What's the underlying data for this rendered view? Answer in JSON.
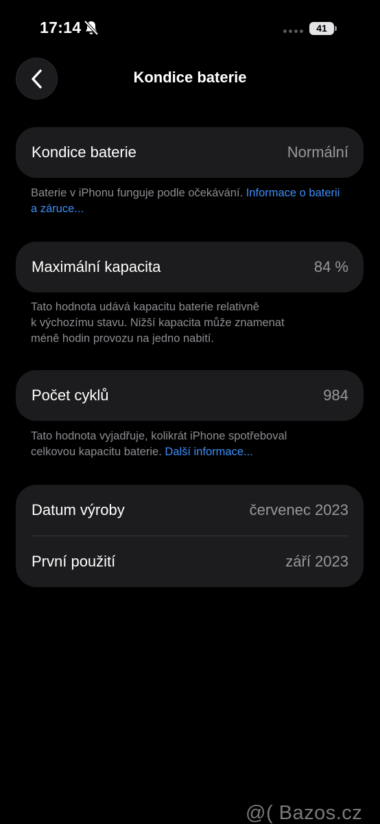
{
  "status_bar": {
    "time": "17:14",
    "battery_level": "41",
    "icons": [
      "bell-slash-icon",
      "signal-dots-icon",
      "battery-icon"
    ]
  },
  "nav": {
    "back_icon": "chevron-left-icon",
    "title": "Kondice baterie"
  },
  "health": {
    "label": "Kondice baterie",
    "value": "Normální",
    "footnote_text": "Baterie v iPhonu funguje podle očekávání. ",
    "footnote_link": "Informace o baterii a záruce..."
  },
  "capacity": {
    "label": "Maximální kapacita",
    "value": "84 %",
    "footnote_line1": "Tato hodnota udává kapacitu baterie relativně",
    "footnote_line2": "k výchozímu stavu. Nižší kapacita může znamenat",
    "footnote_line3": "méně hodin provozu na jedno nabití."
  },
  "cycles": {
    "label": "Počet cyklů",
    "value": "984",
    "footnote_line1": "Tato hodnota vyjadřuje, kolikrát iPhone spotřeboval",
    "footnote_text2": "celkovou kapacitu baterie. ",
    "footnote_link": "Další informace..."
  },
  "dates": {
    "manufacture_label": "Datum výroby",
    "manufacture_value": "červenec 2023",
    "first_use_label": "První použití",
    "first_use_value": "září 2023"
  },
  "watermark": "@( Bazos.cz",
  "colors": {
    "background": "#000000",
    "card": "#1c1c1e",
    "secondary_text": "#98989d",
    "link": "#3e8ef7"
  }
}
